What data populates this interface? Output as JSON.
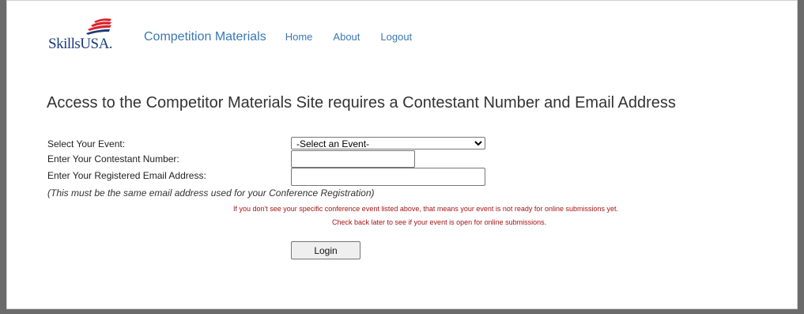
{
  "logo": {
    "text": "SkillsUSA."
  },
  "nav": {
    "brand": "Competition Materials",
    "links": [
      "Home",
      "About",
      "Logout"
    ]
  },
  "title": "Access to the Competitor Materials Site requires a Contestant Number and Email Address",
  "form": {
    "event_label": "Select Your Event:",
    "event_selected": "-Select an Event-",
    "contestant_label": "Enter Your Contestant Number:",
    "contestant_value": "",
    "email_label": "Enter Your Registered Email Address:",
    "email_value": "",
    "note": "(This must be the same email address used for your Conference Registration)",
    "warning_1": "If you don't see your specific conference event listed above, that means your event is not ready for online submissions yet.",
    "warning_2": "Check back later to see if your event is open for online submissions.",
    "login_label": "Login"
  },
  "colors": {
    "link": "#3a78b5",
    "warning": "#a31515",
    "brand_blue": "#1a3b7a",
    "brand_red": "#d9242b"
  }
}
